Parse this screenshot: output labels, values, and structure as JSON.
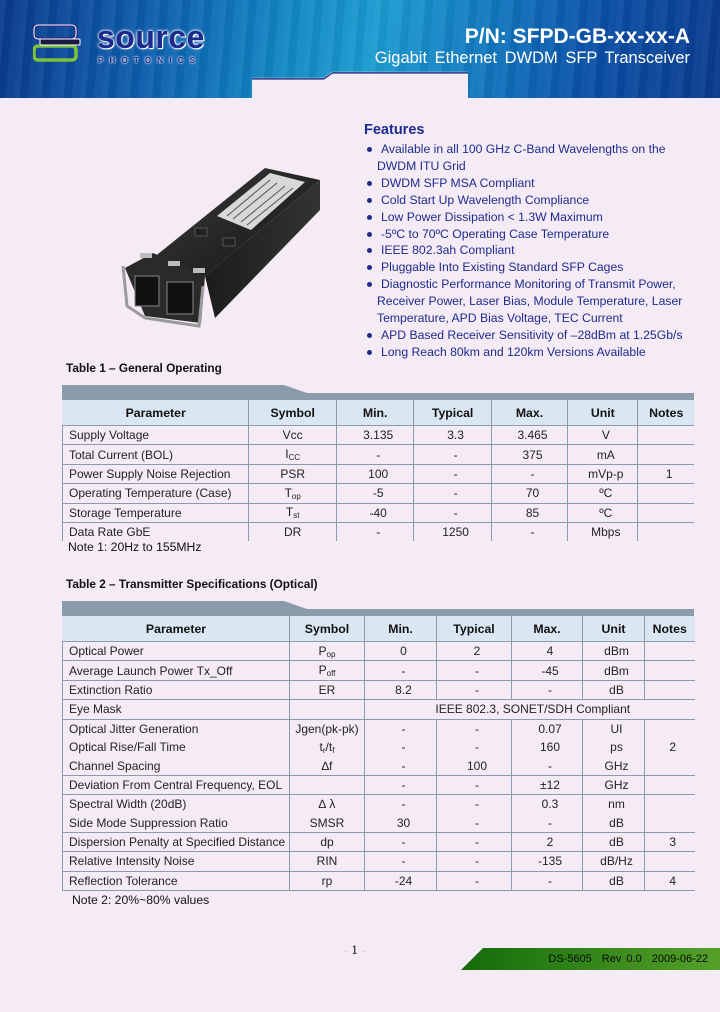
{
  "header": {
    "logo_word": "source",
    "logo_sub": "PHOTONICS",
    "part_number": "P/N: SFPD-GB-xx-xx-A",
    "subtitle": "Gigabit Ethernet DWDM SFP Transceiver"
  },
  "product_image": {
    "alt": "SFP transceiver module",
    "icon": "sfp-module-photo"
  },
  "features": {
    "title": "Features",
    "items": [
      [
        "Available in all 100 GHz C-Band Wavelengths on the",
        "DWDM ITU Grid"
      ],
      [
        "DWDM SFP MSA Compliant"
      ],
      [
        "Cold Start Up Wavelength Compliance"
      ],
      [
        "Low Power Dissipation < 1.3W Maximum"
      ],
      [
        "-5ºC to 70ºC Operating Case Temperature"
      ],
      [
        "IEEE 802.3ah Compliant"
      ],
      [
        "Pluggable Into Existing Standard SFP Cages"
      ],
      [
        "Diagnostic Performance Monitoring of Transmit Power,",
        "Receiver Power, Laser Bias, Module Temperature, Laser",
        "Temperature, APD Bias Voltage, TEC Current"
      ],
      [
        "APD Based Receiver Sensitivity of –28dBm at 1.25Gb/s"
      ],
      [
        "Long Reach 80km and 120km Versions Available"
      ]
    ]
  },
  "table1": {
    "title": "Table 1 – General Operating",
    "columns": [
      "Parameter",
      "Symbol",
      "Min.",
      "Typical",
      "Max.",
      "Unit",
      "Notes"
    ],
    "rows": [
      {
        "parameter": "Supply Voltage",
        "symbol": "Vcc",
        "symbol_sub": "",
        "min": "3.135",
        "typ": "3.3",
        "max": "3.465",
        "unit": "V",
        "notes": ""
      },
      {
        "parameter": "Total Current (BOL)",
        "symbol": "I",
        "symbol_sub": "CC",
        "min": "-",
        "typ": "-",
        "max": "375",
        "unit": "mA",
        "notes": ""
      },
      {
        "parameter": "Power Supply Noise Rejection",
        "symbol": "PSR",
        "symbol_sub": "",
        "min": "100",
        "typ": "-",
        "max": "-",
        "unit": "mVp-p",
        "notes": "1"
      },
      {
        "parameter": "Operating Temperature (Case)",
        "symbol": "T",
        "symbol_sub": "op",
        "min": "-5",
        "typ": "-",
        "max": "70",
        "unit": "ºC",
        "notes": ""
      },
      {
        "parameter": "Storage Temperature",
        "symbol": "T",
        "symbol_sub": "st",
        "min": "-40",
        "typ": "-",
        "max": "85",
        "unit": "ºC",
        "notes": ""
      },
      {
        "parameter": "Data Rate GbE",
        "symbol": "DR",
        "symbol_sub": "",
        "min": "-",
        "typ": "1250",
        "max": "-",
        "unit": "Mbps",
        "notes": ""
      }
    ],
    "note": "Note 1: 20Hz to 155MHz"
  },
  "table2": {
    "title": "Table 2 – Transmitter Specifications (Optical)",
    "columns": [
      "Parameter",
      "Symbol",
      "Min.",
      "Typical",
      "Max.",
      "Unit",
      "Notes"
    ],
    "rows": [
      {
        "parameter": "Optical Power",
        "symbol": "P",
        "symbol_sub": "op",
        "min": "0",
        "typ": "2",
        "max": "4",
        "unit": "dBm",
        "notes": ""
      },
      {
        "parameter": "Average Launch Power Tx_Off",
        "symbol": "P",
        "symbol_sub": "off",
        "min": "-",
        "typ": "-",
        "max": "-45",
        "unit": "dBm",
        "notes": ""
      },
      {
        "parameter": "Extinction Ratio",
        "symbol": "ER",
        "symbol_sub": "",
        "min": "8.2",
        "typ": "-",
        "max": "-",
        "unit": "dB",
        "notes": ""
      },
      {
        "parameter": "Eye Mask",
        "symbol": "",
        "symbol_sub": "",
        "span_text": "IEEE 802.3, SONET/SDH Compliant"
      },
      {
        "parameter": "Optical Jitter Generation",
        "symbol": "Jgen(pk-pk)",
        "symbol_sub": "",
        "min": "-",
        "typ": "-",
        "max": "0.07",
        "unit": "UI",
        "notes": ""
      },
      {
        "parameter": "Optical Rise/Fall Time",
        "symbol": "t",
        "symbol_sub": "r",
        "symbol_suffix": "/t",
        "symbol_sub2": "f",
        "min": "-",
        "typ": "-",
        "max": "160",
        "unit": "ps",
        "notes": "2"
      },
      {
        "parameter": "Channel Spacing",
        "symbol": "∆f",
        "symbol_sub": "",
        "min": "-",
        "typ": "100",
        "max": "-",
        "unit": "GHz",
        "notes": ""
      },
      {
        "parameter": "Deviation From Central Frequency, EOL",
        "symbol": "",
        "symbol_sub": "",
        "min": "-",
        "typ": "-",
        "max": "±12",
        "unit": "GHz",
        "notes": ""
      },
      {
        "parameter": "Spectral Width (20dB)",
        "symbol": "∆ λ",
        "symbol_sub": "",
        "min": "-",
        "typ": "-",
        "max": "0.3",
        "unit": "nm",
        "notes": ""
      },
      {
        "parameter": "Side Mode Suppression Ratio",
        "symbol": "SMSR",
        "symbol_sub": "",
        "min": "30",
        "typ": "-",
        "max": "-",
        "unit": "dB",
        "notes": ""
      },
      {
        "parameter": "Dispersion Penalty at Specified Distance",
        "symbol": "dp",
        "symbol_sub": "",
        "min": "-",
        "typ": "-",
        "max": "2",
        "unit": "dB",
        "notes": "3"
      },
      {
        "parameter": "Relative Intensity Noise",
        "symbol": "RIN",
        "symbol_sub": "",
        "min": "-",
        "typ": "-",
        "max": "-135",
        "unit": "dB/Hz",
        "notes": ""
      },
      {
        "parameter": "Reflection Tolerance",
        "symbol": "rp",
        "symbol_sub": "",
        "min": "-24",
        "typ": "-",
        "max": "-",
        "unit": "dB",
        "notes": "4"
      }
    ],
    "note": "Note 2: 20%~80% values"
  },
  "footer": {
    "page_number": "1",
    "doc_id": "DS-5605",
    "revision": "Rev 0.0",
    "date": "2009-06-22"
  },
  "colors": {
    "banner_dark": "#0a3a8c",
    "banner_light": "#1b9bd0",
    "feature_text": "#1d2b8e",
    "table_header_bg": "#dbe6f3",
    "table_bar": "#8a9bab",
    "footer_green": "#2e7d12",
    "page_bg": "#f5ebf5"
  }
}
